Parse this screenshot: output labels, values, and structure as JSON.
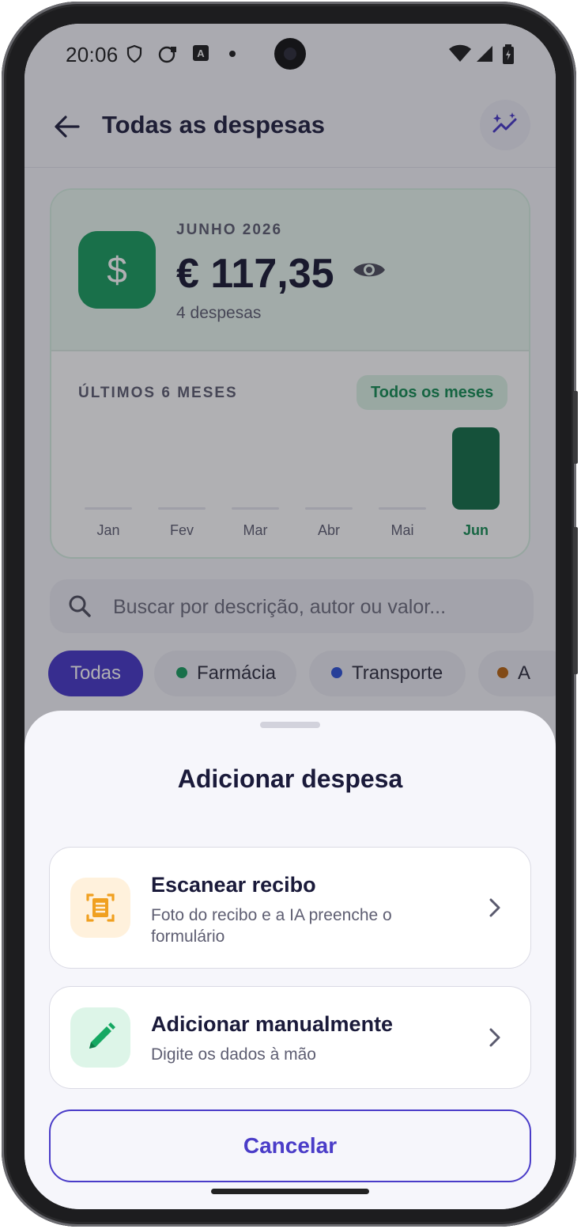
{
  "status": {
    "time": "20:06"
  },
  "header": {
    "title": "Todas as despesas"
  },
  "summary": {
    "month": "JUNHO 2026",
    "amount": "€ 117,35",
    "count": "4 despesas",
    "last_months_label": "ÚLTIMOS 6 MESES",
    "all_months_button": "Todos os meses",
    "bars": [
      {
        "label": "Jan",
        "value": 0
      },
      {
        "label": "Fev",
        "value": 0
      },
      {
        "label": "Mar",
        "value": 0
      },
      {
        "label": "Abr",
        "value": 0
      },
      {
        "label": "Mai",
        "value": 0
      },
      {
        "label": "Jun",
        "value": 117.35
      }
    ],
    "colors": {
      "accent": "#139b5c",
      "bar_active": "#0e6b43",
      "bar_idle": "#e4e4ee"
    }
  },
  "search": {
    "placeholder": "Buscar por descrição, autor ou valor..."
  },
  "chips": [
    {
      "label": "Todas",
      "active": true
    },
    {
      "label": "Farmácia",
      "dot": "#139b5c"
    },
    {
      "label": "Transporte",
      "dot": "#2a4fd6"
    },
    {
      "label": "A",
      "dot": "#b8620b"
    }
  ],
  "sheet": {
    "title": "Adicionar despesa",
    "options": [
      {
        "title": "Escanear recibo",
        "subtitle": "Foto do recibo e a IA preenche o formulário",
        "icon": "receipt-scan-icon"
      },
      {
        "title": "Adicionar manualmente",
        "subtitle": "Digite os dados à mão",
        "icon": "pencil-icon"
      }
    ],
    "cancel": "Cancelar"
  }
}
